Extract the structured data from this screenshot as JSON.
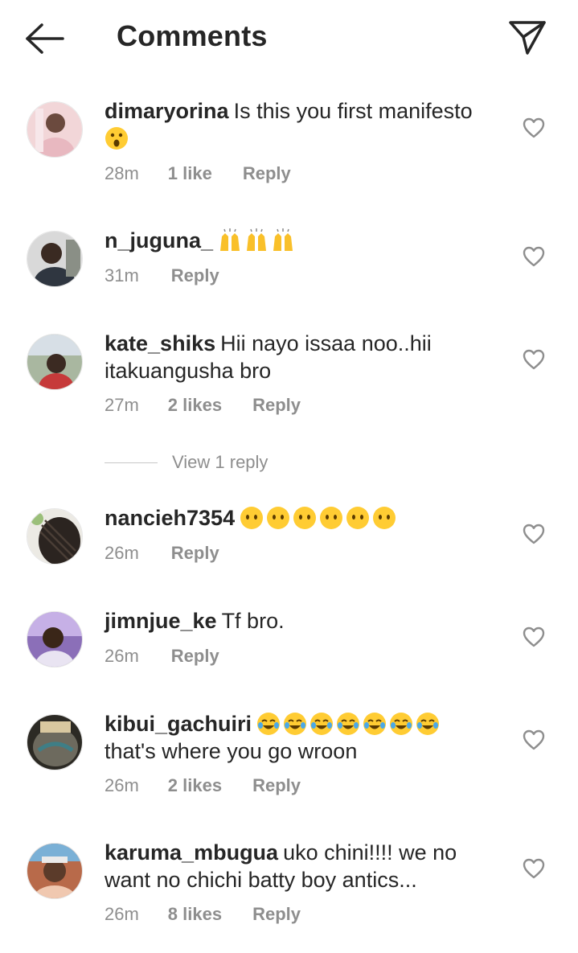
{
  "header": {
    "title": "Comments",
    "back_icon": "arrow-left-icon",
    "share_icon": "paper-plane-icon"
  },
  "colors": {
    "text": "#262626",
    "secondary": "#8e8e8e",
    "divider": "#c7c7c7"
  },
  "comments": [
    {
      "username": "dimaryorina",
      "text": "Is this you first manifesto",
      "emoji": [
        "😮"
      ],
      "time": "28m",
      "likes": "1 like",
      "reply": "Reply"
    },
    {
      "username": "n_juguna_",
      "text": "",
      "emoji": [
        "🙌",
        "🙌",
        "🙌"
      ],
      "time": "31m",
      "likes": "",
      "reply": "Reply"
    },
    {
      "username": "kate_shiks",
      "text": "Hii nayo issaa noo..hii itakuangusha bro",
      "emoji": [],
      "time": "27m",
      "likes": "2 likes",
      "reply": "Reply",
      "view_replies": "View 1 reply"
    },
    {
      "username": "nancieh7354",
      "text": "",
      "emoji": [
        "😶",
        "😶",
        "😶",
        "😶",
        "😶",
        "😶"
      ],
      "time": "26m",
      "likes": "",
      "reply": "Reply"
    },
    {
      "username": "jimnjue_ke",
      "text": "Tf bro.",
      "emoji": [],
      "time": "26m",
      "likes": "",
      "reply": "Reply"
    },
    {
      "username": "kibui_gachuiri",
      "text": "",
      "emoji": [
        "😂",
        "😂",
        "😂",
        "😂",
        "😂",
        "😂",
        "😂"
      ],
      "text_after": "that's where you go wroon",
      "time": "26m",
      "likes": "2 likes",
      "reply": "Reply"
    },
    {
      "username": "karuma_mbugua",
      "text": "uko chini!!!! we no want no chichi batty boy antics...",
      "emoji": [],
      "time": "26m",
      "likes": "8 likes",
      "reply": "Reply"
    }
  ]
}
